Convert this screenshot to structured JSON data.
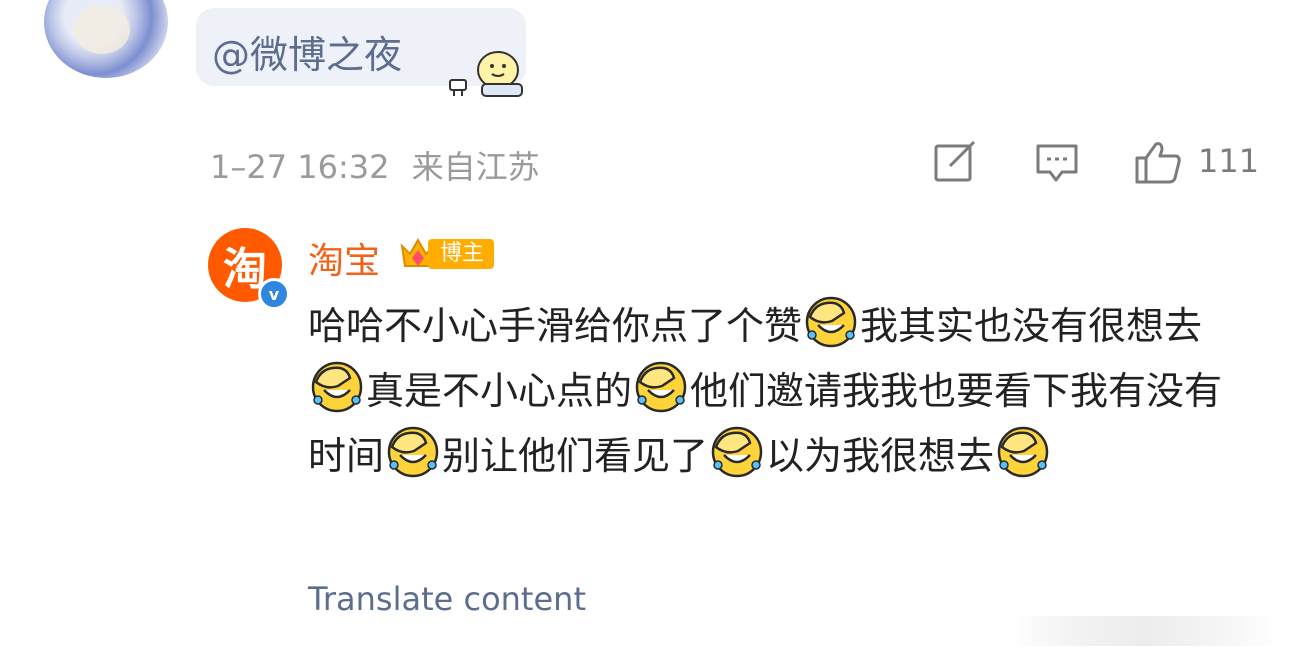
{
  "comment": {
    "mention": "@微博之夜",
    "timestamp": "1–27 16:32",
    "location": "来自江苏",
    "like_count": "111",
    "icons": [
      "edit-icon",
      "comment-icon",
      "like-icon"
    ]
  },
  "reply": {
    "author": "淘宝",
    "avatar_glyph": "淘",
    "verified_glyph": "v",
    "badge_label": "博主",
    "segments": [
      {
        "text": "哈哈不小心手滑给你点了个赞",
        "emoji": "facepalm-laugh-emoji"
      },
      {
        "text": "我其实也没有很想去",
        "emoji": "facepalm-laugh-emoji"
      },
      {
        "text": "真是不小心点的",
        "emoji": "facepalm-laugh-emoji"
      },
      {
        "text": "他们邀请我我也要看下我有没有时间",
        "emoji": "facepalm-laugh-emoji"
      },
      {
        "text": "别让他们看见了",
        "emoji": "facepalm-laugh-emoji"
      },
      {
        "text": "以为我很想去",
        "emoji": "facepalm-laugh-emoji"
      }
    ],
    "translate_label": "Translate content"
  },
  "colors": {
    "mention": "#5d6d8f",
    "author": "#f0631a",
    "avatar_bg": "#ff5a00",
    "badge_bg": "#ffad00",
    "meta": "#9a9a9a"
  }
}
